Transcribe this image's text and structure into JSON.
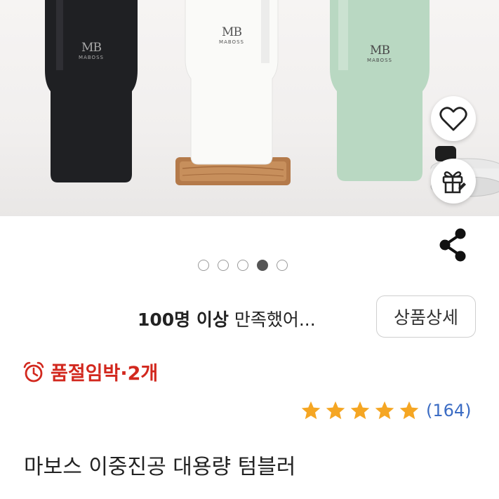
{
  "product_image": {
    "tumblers": [
      {
        "color": "black",
        "fill": "#1e1f22",
        "logo_color": "#9a9a9a"
      },
      {
        "color": "white",
        "fill": "#f7f7f5",
        "logo_color": "#555555"
      },
      {
        "color": "mint",
        "fill": "#b8d6c0",
        "logo_color": "#4a4a4a"
      }
    ],
    "logo_mark": "MB",
    "logo_word": "MABOSS"
  },
  "actions": {
    "wishlist_icon": "heart-icon",
    "gift_icon": "gift-icon",
    "share_icon": "share-icon"
  },
  "carousel": {
    "total": 5,
    "active_index": 3
  },
  "review_summary": {
    "bold_text": "100명 이상",
    "rest_text": " 만족했어...",
    "detail_button": "상품상세"
  },
  "stock": {
    "icon": "alarm-clock-icon",
    "text": "품절임박·2개",
    "color": "#d2281e"
  },
  "rating": {
    "stars": 5,
    "count_text": "(164)",
    "star_color": "#f5a623"
  },
  "product_title": "마보스 이중진공 대용량 텀블러"
}
